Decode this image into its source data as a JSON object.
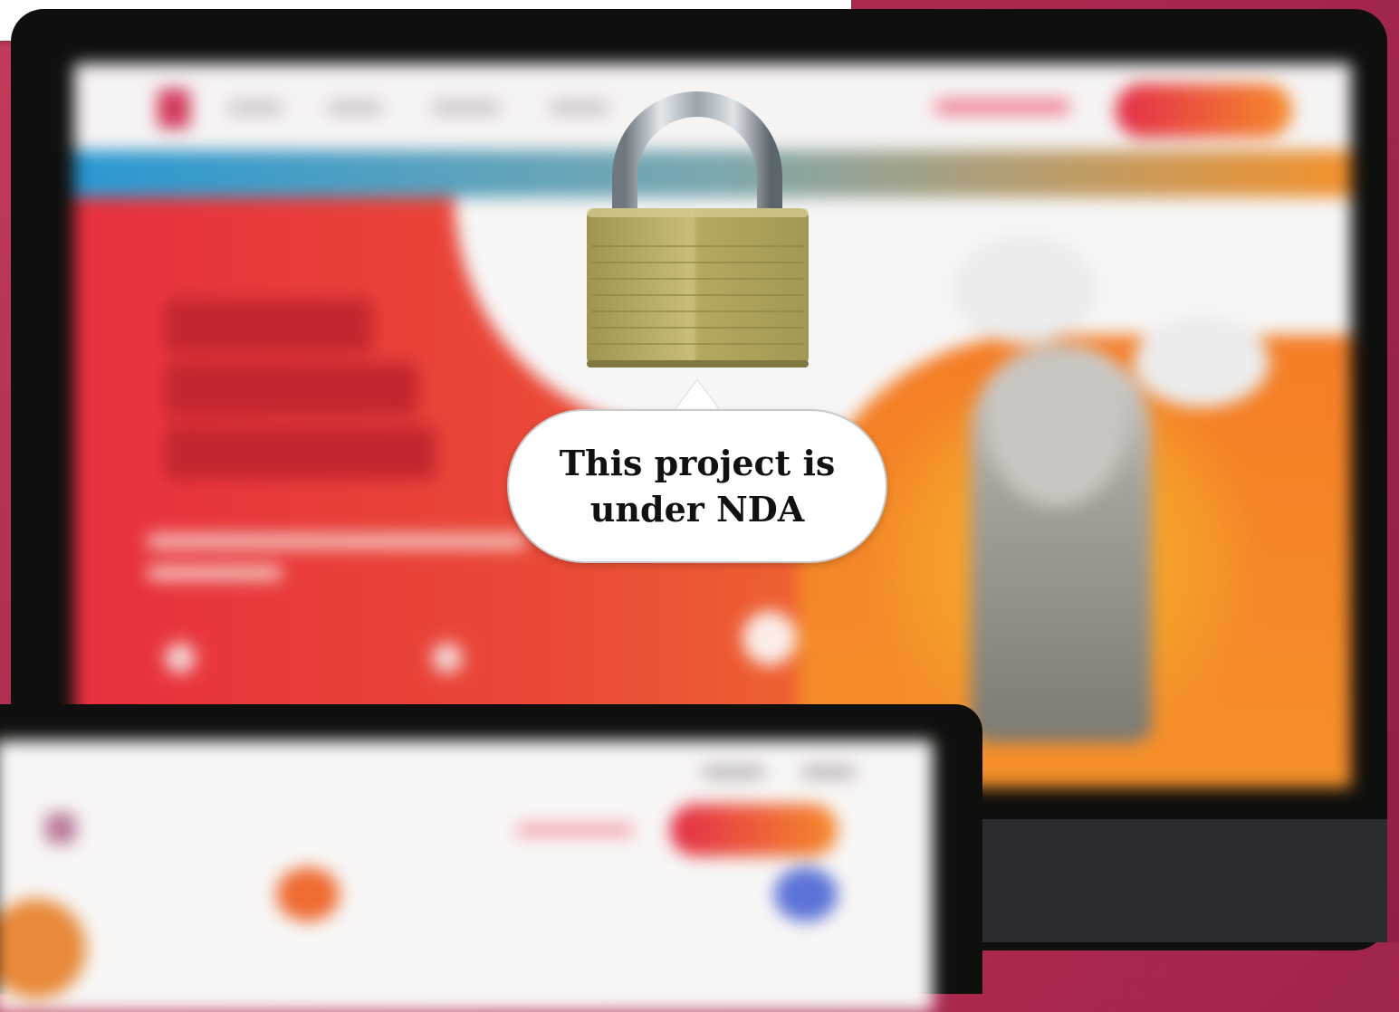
{
  "overlay": {
    "message": "This project is under NDA",
    "lock_icon": "padlock-icon"
  },
  "colors": {
    "background": "#a8284c",
    "device_frame": "#0f0f0d",
    "hero_red": "#e8303e",
    "hero_orange": "#f47e28",
    "brand_gradient_start": "#e32d4a",
    "brand_gradient_end": "#f68a2b",
    "padlock_brass": "#b5a860"
  }
}
